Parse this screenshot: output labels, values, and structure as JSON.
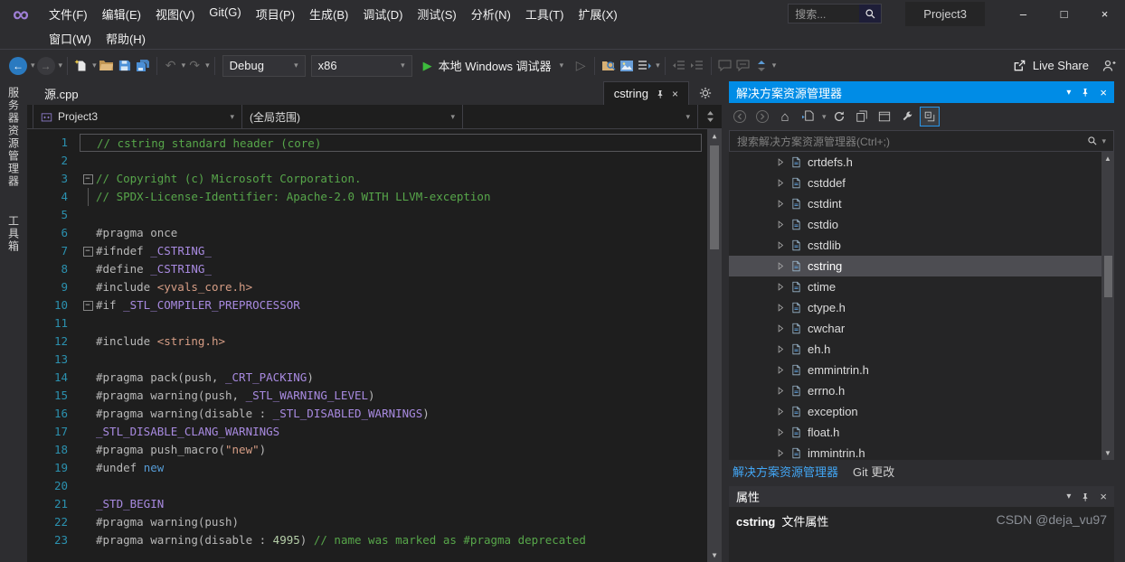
{
  "colors": {
    "accent": "#008ce6",
    "titlebar_bg": "#2d2d30",
    "editor_bg": "#1e1e1e",
    "panel_bg": "#252526",
    "selection_bg": "#4d4d52",
    "line_number": "#2b91af",
    "comment": "#57a64a",
    "preprocessor": "#b8b8b8",
    "macro": "#a88ae0",
    "string": "#d69d85",
    "keyword": "#569cd6",
    "number": "#b5cea8"
  },
  "icons": {
    "logo": "∞",
    "minimize": "–",
    "maximize": "□",
    "close": "×",
    "caret": "▾",
    "back": "←",
    "forward": "→",
    "undo": "↶",
    "redo": "↷",
    "play": "▶",
    "play_outline": "▷",
    "home": "⌂",
    "up": "▲",
    "down": "▼",
    "fold_minus": "−",
    "splitter": "▲▼"
  },
  "titlebar": {
    "menus_row1": [
      "文件(F)",
      "编辑(E)",
      "视图(V)",
      "Git(G)",
      "项目(P)",
      "生成(B)",
      "调试(D)",
      "测试(S)",
      "分析(N)",
      "工具(T)",
      "扩展(X)"
    ],
    "menus_row2": [
      "窗口(W)",
      "帮助(H)"
    ],
    "search_placeholder": "搜索...",
    "window_title": "Project3"
  },
  "toolbar": {
    "config": "Debug",
    "platform": "x86",
    "start_debug_label": "本地 Windows 调试器",
    "live_share_label": "Live Share"
  },
  "activity_bar": {
    "items": [
      "服务器资源管理器",
      "工具箱"
    ]
  },
  "editor": {
    "tabs": [
      {
        "label": "源.cpp"
      },
      {
        "label": "cstring",
        "preview": true
      }
    ],
    "nav": {
      "project": "Project3",
      "scope": "(全局范围)",
      "member": ""
    },
    "lines": [
      {
        "n": 1,
        "current": true,
        "segs": [
          [
            "cm",
            "// cstring standard header (core)"
          ]
        ]
      },
      {
        "n": 2,
        "segs": []
      },
      {
        "n": 3,
        "fold": "minus",
        "segs": [
          [
            "cm",
            "// Copyright (c) Microsoft Corporation."
          ]
        ]
      },
      {
        "n": 4,
        "fold": "bar",
        "segs": [
          [
            "cm",
            "// SPDX-License-Identifier: Apache-2.0 WITH LLVM-exception"
          ]
        ]
      },
      {
        "n": 5,
        "segs": []
      },
      {
        "n": 6,
        "segs": [
          [
            "pp",
            "#pragma once"
          ]
        ]
      },
      {
        "n": 7,
        "fold": "minus",
        "segs": [
          [
            "pp",
            "#ifndef "
          ],
          [
            "mac",
            "_CSTRING_"
          ]
        ]
      },
      {
        "n": 8,
        "segs": [
          [
            "pp",
            "#define "
          ],
          [
            "mac",
            "_CSTRING_"
          ]
        ]
      },
      {
        "n": 9,
        "segs": [
          [
            "pp",
            "#include "
          ],
          [
            "str",
            "<yvals_core.h>"
          ]
        ]
      },
      {
        "n": 10,
        "fold": "minus",
        "segs": [
          [
            "pp",
            "#if "
          ],
          [
            "mac",
            "_STL_COMPILER_PREPROCESSOR"
          ]
        ]
      },
      {
        "n": 11,
        "segs": []
      },
      {
        "n": 12,
        "segs": [
          [
            "pp",
            "#include "
          ],
          [
            "str",
            "<string.h>"
          ]
        ]
      },
      {
        "n": 13,
        "segs": []
      },
      {
        "n": 14,
        "segs": [
          [
            "pp",
            "#pragma pack(push, "
          ],
          [
            "mac",
            "_CRT_PACKING"
          ],
          [
            "pp",
            ")"
          ]
        ]
      },
      {
        "n": 15,
        "segs": [
          [
            "pp",
            "#pragma warning(push, "
          ],
          [
            "mac",
            "_STL_WARNING_LEVEL"
          ],
          [
            "pp",
            ")"
          ]
        ]
      },
      {
        "n": 16,
        "segs": [
          [
            "pp",
            "#pragma warning(disable : "
          ],
          [
            "mac",
            "_STL_DISABLED_WARNINGS"
          ],
          [
            "pp",
            ")"
          ]
        ]
      },
      {
        "n": 17,
        "segs": [
          [
            "mac",
            "_STL_DISABLE_CLANG_WARNINGS"
          ]
        ]
      },
      {
        "n": 18,
        "segs": [
          [
            "pp",
            "#pragma push_macro("
          ],
          [
            "str",
            "\"new\""
          ],
          [
            "pp",
            ")"
          ]
        ]
      },
      {
        "n": 19,
        "segs": [
          [
            "pp",
            "#undef "
          ],
          [
            "kw",
            "new"
          ]
        ]
      },
      {
        "n": 20,
        "segs": []
      },
      {
        "n": 21,
        "segs": [
          [
            "mac",
            "_STD_BEGIN"
          ]
        ]
      },
      {
        "n": 22,
        "segs": [
          [
            "pp",
            "#pragma warning(push)"
          ]
        ]
      },
      {
        "n": 23,
        "segs": [
          [
            "pp",
            "#pragma warning(disable : "
          ],
          [
            "num",
            "4995"
          ],
          [
            "pp",
            ") "
          ],
          [
            "cm",
            "// name was marked as #pragma deprecated"
          ]
        ]
      }
    ]
  },
  "solution_explorer": {
    "title": "解决方案资源管理器",
    "search_placeholder": "搜索解决方案资源管理器(Ctrl+;)",
    "items": [
      {
        "label": "crtdefs.h",
        "icon": "cpp-header-file-icon"
      },
      {
        "label": "cstddef",
        "icon": "cpp-header-file-icon"
      },
      {
        "label": "cstdint",
        "icon": "cpp-header-file-icon"
      },
      {
        "label": "cstdio",
        "icon": "cpp-header-file-icon"
      },
      {
        "label": "cstdlib",
        "icon": "cpp-header-file-icon"
      },
      {
        "label": "cstring",
        "icon": "cpp-header-file-icon"
      },
      {
        "label": "ctime",
        "icon": "cpp-header-file-icon"
      },
      {
        "label": "ctype.h",
        "icon": "cpp-header-file-icon"
      },
      {
        "label": "cwchar",
        "icon": "cpp-header-file-icon"
      },
      {
        "label": "eh.h",
        "icon": "cpp-header-file-icon"
      },
      {
        "label": "emmintrin.h",
        "icon": "cpp-header-file-icon"
      },
      {
        "label": "errno.h",
        "icon": "cpp-header-file-icon"
      },
      {
        "label": "exception",
        "icon": "cpp-header-file-icon"
      },
      {
        "label": "float.h",
        "icon": "cpp-header-file-icon"
      },
      {
        "label": "immintrin.h",
        "icon": "cpp-header-file-icon"
      }
    ],
    "selected_item": "cstring",
    "tabs": [
      {
        "label": "解决方案资源管理器",
        "active": true
      },
      {
        "label": "Git 更改",
        "active": false
      }
    ]
  },
  "properties": {
    "title": "属性",
    "object_name": "cstring",
    "object_type": "文件属性",
    "watermark": "CSDN @deja_vu97"
  }
}
